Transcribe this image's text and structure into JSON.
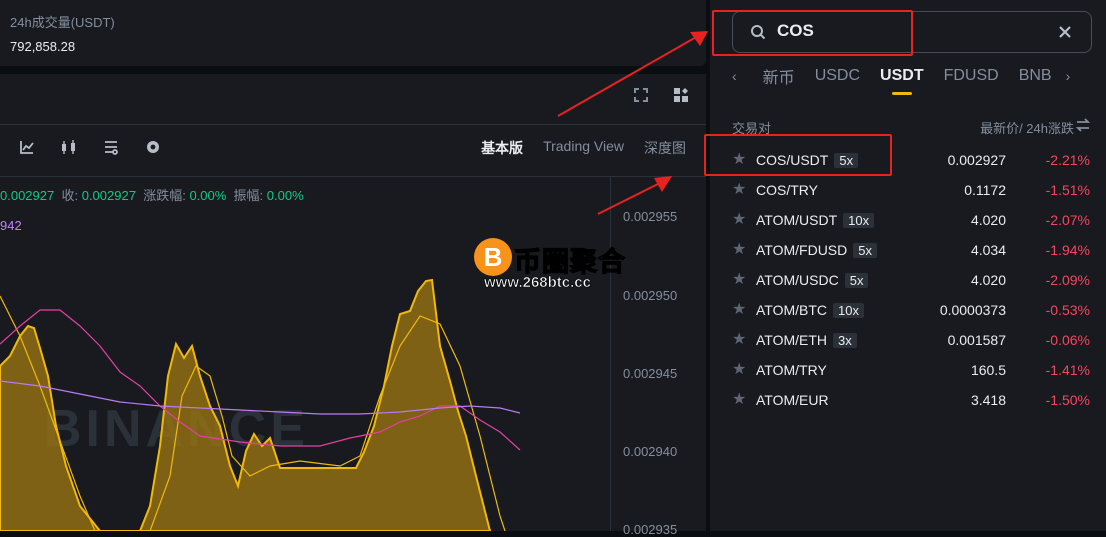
{
  "volume": {
    "label": "24h成交量(USDT)",
    "value": "792,858.28"
  },
  "chart": {
    "view_tabs": [
      "基本版",
      "Trading View",
      "深度图"
    ],
    "ohlc": {
      "open_value": "0.002927",
      "close_label": "收:",
      "close_value": "0.002927",
      "change_label": "涨跌幅:",
      "change_value": "0.00%",
      "amp_label": "振幅:",
      "amp_value": "0.00%"
    },
    "ma_label": "942",
    "price_ticks": [
      "0.002955",
      "0.002950",
      "0.002945",
      "0.002940",
      "0.002935"
    ],
    "watermark_brand": "BINANCE"
  },
  "watermark": {
    "logo": "B",
    "title": "币圈聚合",
    "url": "www.268btc.cc"
  },
  "market": {
    "search": {
      "value": "COS"
    },
    "tabs": [
      "新币",
      "USDC",
      "USDT",
      "FDUSD",
      "BNB"
    ],
    "active_tab": "USDT",
    "header": {
      "pair": "交易对",
      "price_change": "最新价/ 24h涨跌"
    },
    "rows": [
      {
        "pair": "COS/USDT",
        "leverage": "5x",
        "price": "0.002927",
        "change": "-2.21%"
      },
      {
        "pair": "COS/TRY",
        "leverage": "",
        "price": "0.1172",
        "change": "-1.51%"
      },
      {
        "pair": "ATOM/USDT",
        "leverage": "10x",
        "price": "4.020",
        "change": "-2.07%"
      },
      {
        "pair": "ATOM/FDUSD",
        "leverage": "5x",
        "price": "4.034",
        "change": "-1.94%"
      },
      {
        "pair": "ATOM/USDC",
        "leverage": "5x",
        "price": "4.020",
        "change": "-2.09%"
      },
      {
        "pair": "ATOM/BTC",
        "leverage": "10x",
        "price": "0.0000373",
        "change": "-0.53%"
      },
      {
        "pair": "ATOM/ETH",
        "leverage": "3x",
        "price": "0.001587",
        "change": "-0.06%"
      },
      {
        "pair": "ATOM/TRY",
        "leverage": "",
        "price": "160.5",
        "change": "-1.41%"
      },
      {
        "pair": "ATOM/EUR",
        "leverage": "",
        "price": "3.418",
        "change": "-1.50%"
      }
    ]
  },
  "colors": {
    "background": "#0b0e11",
    "panel": "#181a20",
    "accent": "#f0b90b",
    "up": "#0ecb81",
    "down": "#f6465d",
    "annotation": "#e8231f"
  }
}
